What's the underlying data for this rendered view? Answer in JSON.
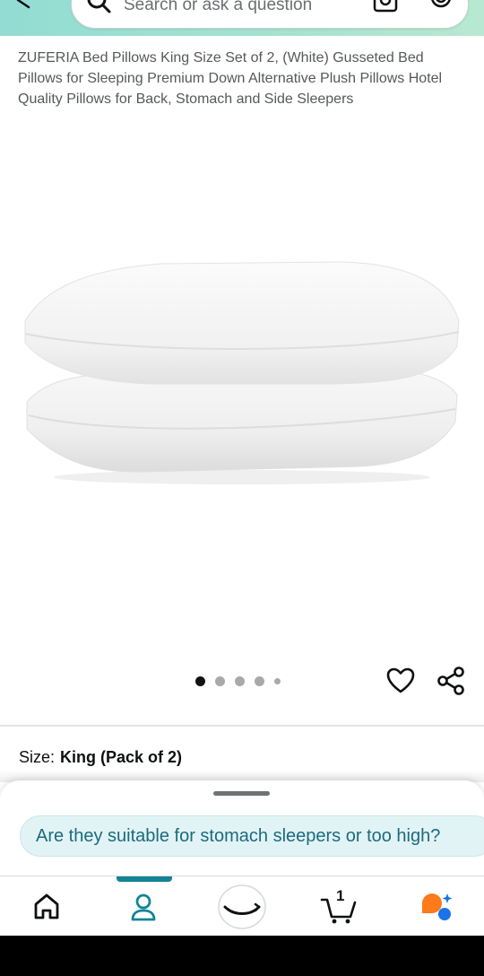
{
  "search": {
    "placeholder": "Search or ask a question"
  },
  "product": {
    "title": "ZUFERIA Bed Pillows King Size Set of 2, (White) Gusseted Bed Pillows for Sleeping Premium Down Alternative Plush Pillows Hotel Quality Pillows for Back, Stomach and Side Sleepers",
    "image_icon": "pillow-pair-image"
  },
  "carousel": {
    "total_dots": 5,
    "active_index": 0
  },
  "actions": {
    "favorite_icon": "heart-icon",
    "share_icon": "share-icon"
  },
  "size": {
    "label": "Size:",
    "value": "King (Pack of 2)"
  },
  "sheet": {
    "suggestion": "Are they suitable for stomach sleepers or too high?"
  },
  "nav": {
    "items": [
      "home-icon",
      "account-icon",
      "amazon-smile-icon",
      "cart-icon",
      "rufus-icon"
    ],
    "active": "account",
    "cart_count": "1"
  },
  "colors": {
    "header_gradient_start": "#92dcd3",
    "accent_teal": "#138496",
    "chip_bg": "#e2f3f6",
    "chip_text": "#1b6b7d",
    "rufus_orange": "#ff7a1a",
    "rufus_blue": "#1a73e8"
  }
}
